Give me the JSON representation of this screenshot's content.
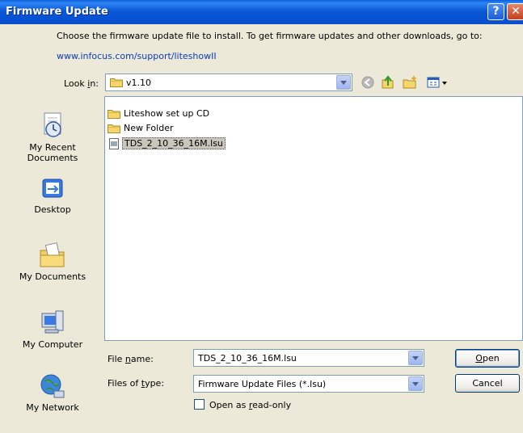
{
  "window": {
    "title": "Firmware Update"
  },
  "titlebar": {
    "help_label": "?",
    "close_label": "✕"
  },
  "instruction": "Choose the firmware update file to install. To get firmware updates and other downloads, go to:",
  "link": "www.infocus.com/support/liteshowII",
  "lookin": {
    "label_prefix": "Look ",
    "label_u": "i",
    "label_suffix": "n:",
    "value": "v1.10"
  },
  "places": [
    {
      "label_line1": "My Recent",
      "label_line2": "Documents",
      "icon": "recent-documents-icon"
    },
    {
      "label_line1": "Desktop",
      "label_line2": "",
      "icon": "desktop-icon"
    },
    {
      "label_line1": "My Documents",
      "label_line2": "",
      "icon": "my-documents-icon"
    },
    {
      "label_line1": "My Computer",
      "label_line2": "",
      "icon": "my-computer-icon"
    },
    {
      "label_line1": "My Network",
      "label_line2": "",
      "icon": "my-network-icon"
    }
  ],
  "files": [
    {
      "name": "Liteshow set up CD",
      "type": "folder"
    },
    {
      "name": "New Folder",
      "type": "folder"
    },
    {
      "name": "TDS_2_10_36_16M.lsu",
      "type": "file",
      "selected": true
    }
  ],
  "filename": {
    "label_prefix": "File ",
    "label_u": "n",
    "label_suffix": "ame:",
    "value": "TDS_2_10_36_16M.lsu"
  },
  "filetype": {
    "label_prefix": "Files of ",
    "label_u": "t",
    "label_suffix": "ype:",
    "value": "Firmware Update Files (*.lsu)"
  },
  "buttons": {
    "open_u": "O",
    "open_rest": "pen",
    "cancel": "Cancel"
  },
  "readonly": {
    "label_prefix": "Open as ",
    "label_u": "r",
    "label_suffix": "ead-only",
    "checked": false
  },
  "colors": {
    "titlebar": "#0a58d6",
    "dialog_bg": "#ece9d8",
    "link": "#0a3cba",
    "selection": "#c9c6bb"
  }
}
